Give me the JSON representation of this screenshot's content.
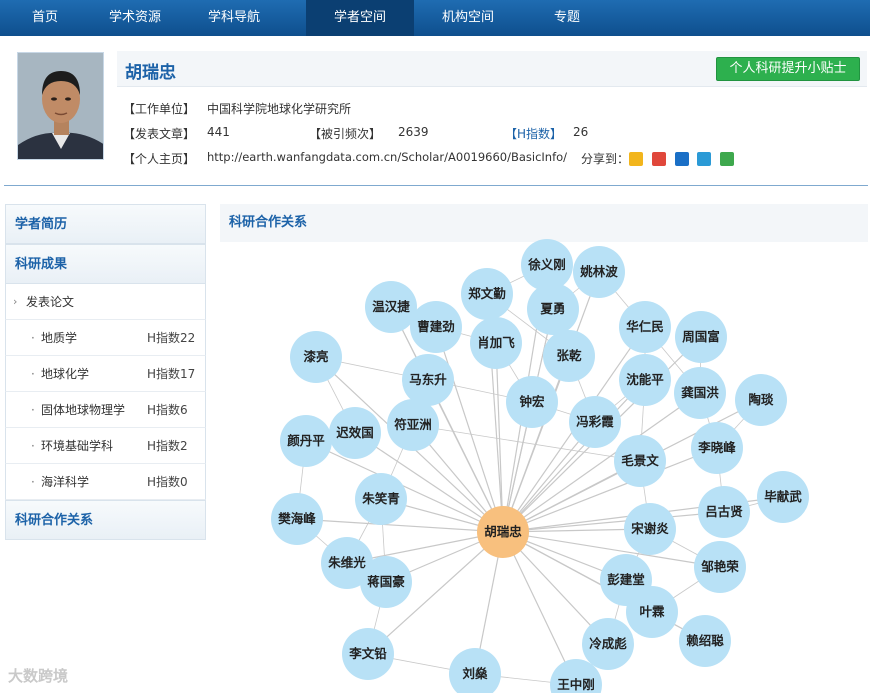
{
  "nav": {
    "items": [
      "首页",
      "学术资源",
      "学科导航",
      "学者空间",
      "机构空间",
      "专题"
    ],
    "active_index": 3
  },
  "profile": {
    "name": "胡瑞忠",
    "tips_button": "个人科研提升小贴士",
    "work_unit_label": "【工作单位】",
    "work_unit": "中国科学院地球化学研究所",
    "papers_label": "【发表文章】",
    "papers": "441",
    "citations_label": "【被引频次】",
    "citations": "2639",
    "h_index_label": "【H指数】",
    "h_index": "26",
    "homepage_label": "【个人主页】",
    "homepage": "http://earth.wanfangdata.com.cn/Scholar/A0019660/BasicInfo/",
    "share_label": "分享到：",
    "share_icons": [
      "qzone-icon",
      "weibo-icon",
      "renren-icon",
      "tencent-icon",
      "douban-icon"
    ]
  },
  "sidebar": {
    "bio": "学者简历",
    "results": "科研成果",
    "papers": "发表论文",
    "subjects": [
      {
        "name": "地质学",
        "h": "H指数22"
      },
      {
        "name": "地球化学",
        "h": "H指数17"
      },
      {
        "name": "固体地球物理学",
        "h": "H指数6"
      },
      {
        "name": "环境基础学科",
        "h": "H指数2"
      },
      {
        "name": "海洋科学",
        "h": "H指数0"
      }
    ],
    "coop": "科研合作关系"
  },
  "coop": {
    "title": "科研合作关系",
    "center": "胡瑞忠",
    "colors": {
      "node": "#b8e1f6",
      "center": "#f8c07e",
      "edge": "#c8c8c8"
    },
    "nodes": [
      "徐义刚",
      "姚林波",
      "郑文勤",
      "温汉捷",
      "夏勇",
      "曹建劲",
      "华仁民",
      "周国富",
      "肖加飞",
      "漆亮",
      "张乾",
      "马东升",
      "沈能平",
      "龚国洪",
      "陶琰",
      "钟宏",
      "符亚洲",
      "冯彩霞",
      "迟效国",
      "颜丹平",
      "李晓峰",
      "毛景文",
      "朱笑青",
      "吕古贤",
      "毕献武",
      "樊海峰",
      "宋谢炎",
      "朱维光",
      "蒋国豪",
      "彭建堂",
      "邹艳荣",
      "叶霖",
      "李文铅",
      "冷成彪",
      "赖绍聪",
      "刘燊",
      "王中刚"
    ]
  },
  "watermark": "大数跨境"
}
